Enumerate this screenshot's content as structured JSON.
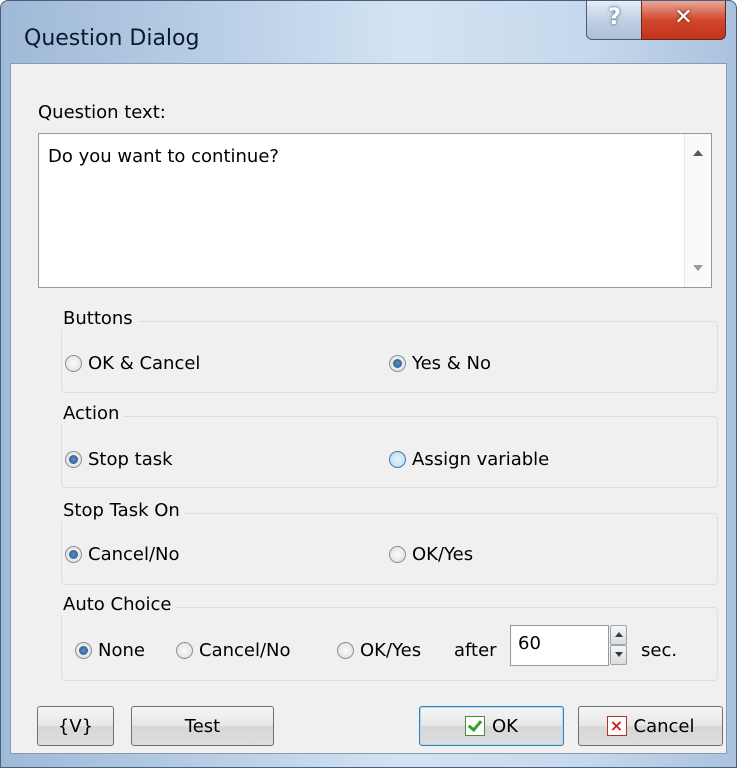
{
  "window": {
    "title": "Question Dialog",
    "help_glyph": "?",
    "close_glyph": "✕"
  },
  "question": {
    "label": "Question text:",
    "value": "Do you want to continue?"
  },
  "buttons_group": {
    "title": "Buttons",
    "options": [
      {
        "label": "OK & Cancel",
        "selected": false
      },
      {
        "label": "Yes & No",
        "selected": true
      }
    ]
  },
  "action_group": {
    "title": "Action",
    "options": [
      {
        "label": "Stop task",
        "selected": true
      },
      {
        "label": "Assign variable",
        "selected": false
      }
    ]
  },
  "stop_task_on_group": {
    "title": "Stop Task On",
    "options": [
      {
        "label": "Cancel/No",
        "selected": true
      },
      {
        "label": "OK/Yes",
        "selected": false
      }
    ]
  },
  "auto_choice_group": {
    "title": "Auto Choice",
    "options": [
      {
        "label": "None",
        "selected": true
      },
      {
        "label": "Cancel/No",
        "selected": false
      },
      {
        "label": "OK/Yes",
        "selected": false
      }
    ],
    "after_label": "after",
    "seconds_value": "60",
    "sec_label": "sec."
  },
  "footer": {
    "variables_label": "{V}",
    "test_label": "Test",
    "ok_label": "OK",
    "cancel_label": "Cancel"
  },
  "colors": {
    "title_gradient_left": "#9fb9d8",
    "close_red": "#c1341b",
    "dialog_bg": "#f0f0f0",
    "radio_dot": "#1e4e86"
  }
}
